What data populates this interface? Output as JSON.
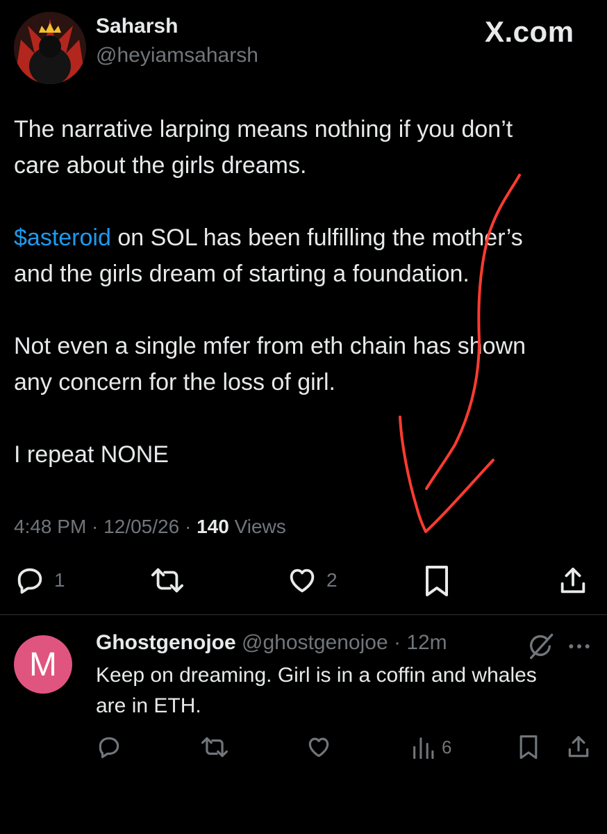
{
  "brand": "X.com",
  "author": {
    "name": "Saharsh",
    "handle": "@heyiamsaharsh"
  },
  "tweet": {
    "line1": "The narrative larping means nothing if you don’t",
    "line2": "care about the girls dreams.",
    "cashtag": "$asteroid",
    "line3_rest": " on SOL has been fulfilling the mother’s",
    "line4": "and the girls dream of starting a foundation.",
    "line5": "Not even a single mfer from eth chain has shown",
    "line6": "any concern for the loss of girl.",
    "line7": "I repeat NONE"
  },
  "meta": {
    "time": "4:48 PM",
    "sep": " · ",
    "date": "12/05/26",
    "views_count": "140",
    "views_label": "Views"
  },
  "actions": {
    "replies": "1",
    "likes": "2"
  },
  "reply": {
    "avatar_letter": "M",
    "name": "Ghostgenojoe",
    "handle": "@ghostgenojoe",
    "sep": " · ",
    "time": "12m",
    "line1": "Keep on dreaming. Girl is in a coffin and whales",
    "line2": "are in ETH.",
    "views": "6"
  },
  "colors": {
    "accent": "#1d9bf0",
    "muted": "#71767b",
    "annotation": "#ff3b30",
    "reply_avatar": "#e0557f"
  }
}
